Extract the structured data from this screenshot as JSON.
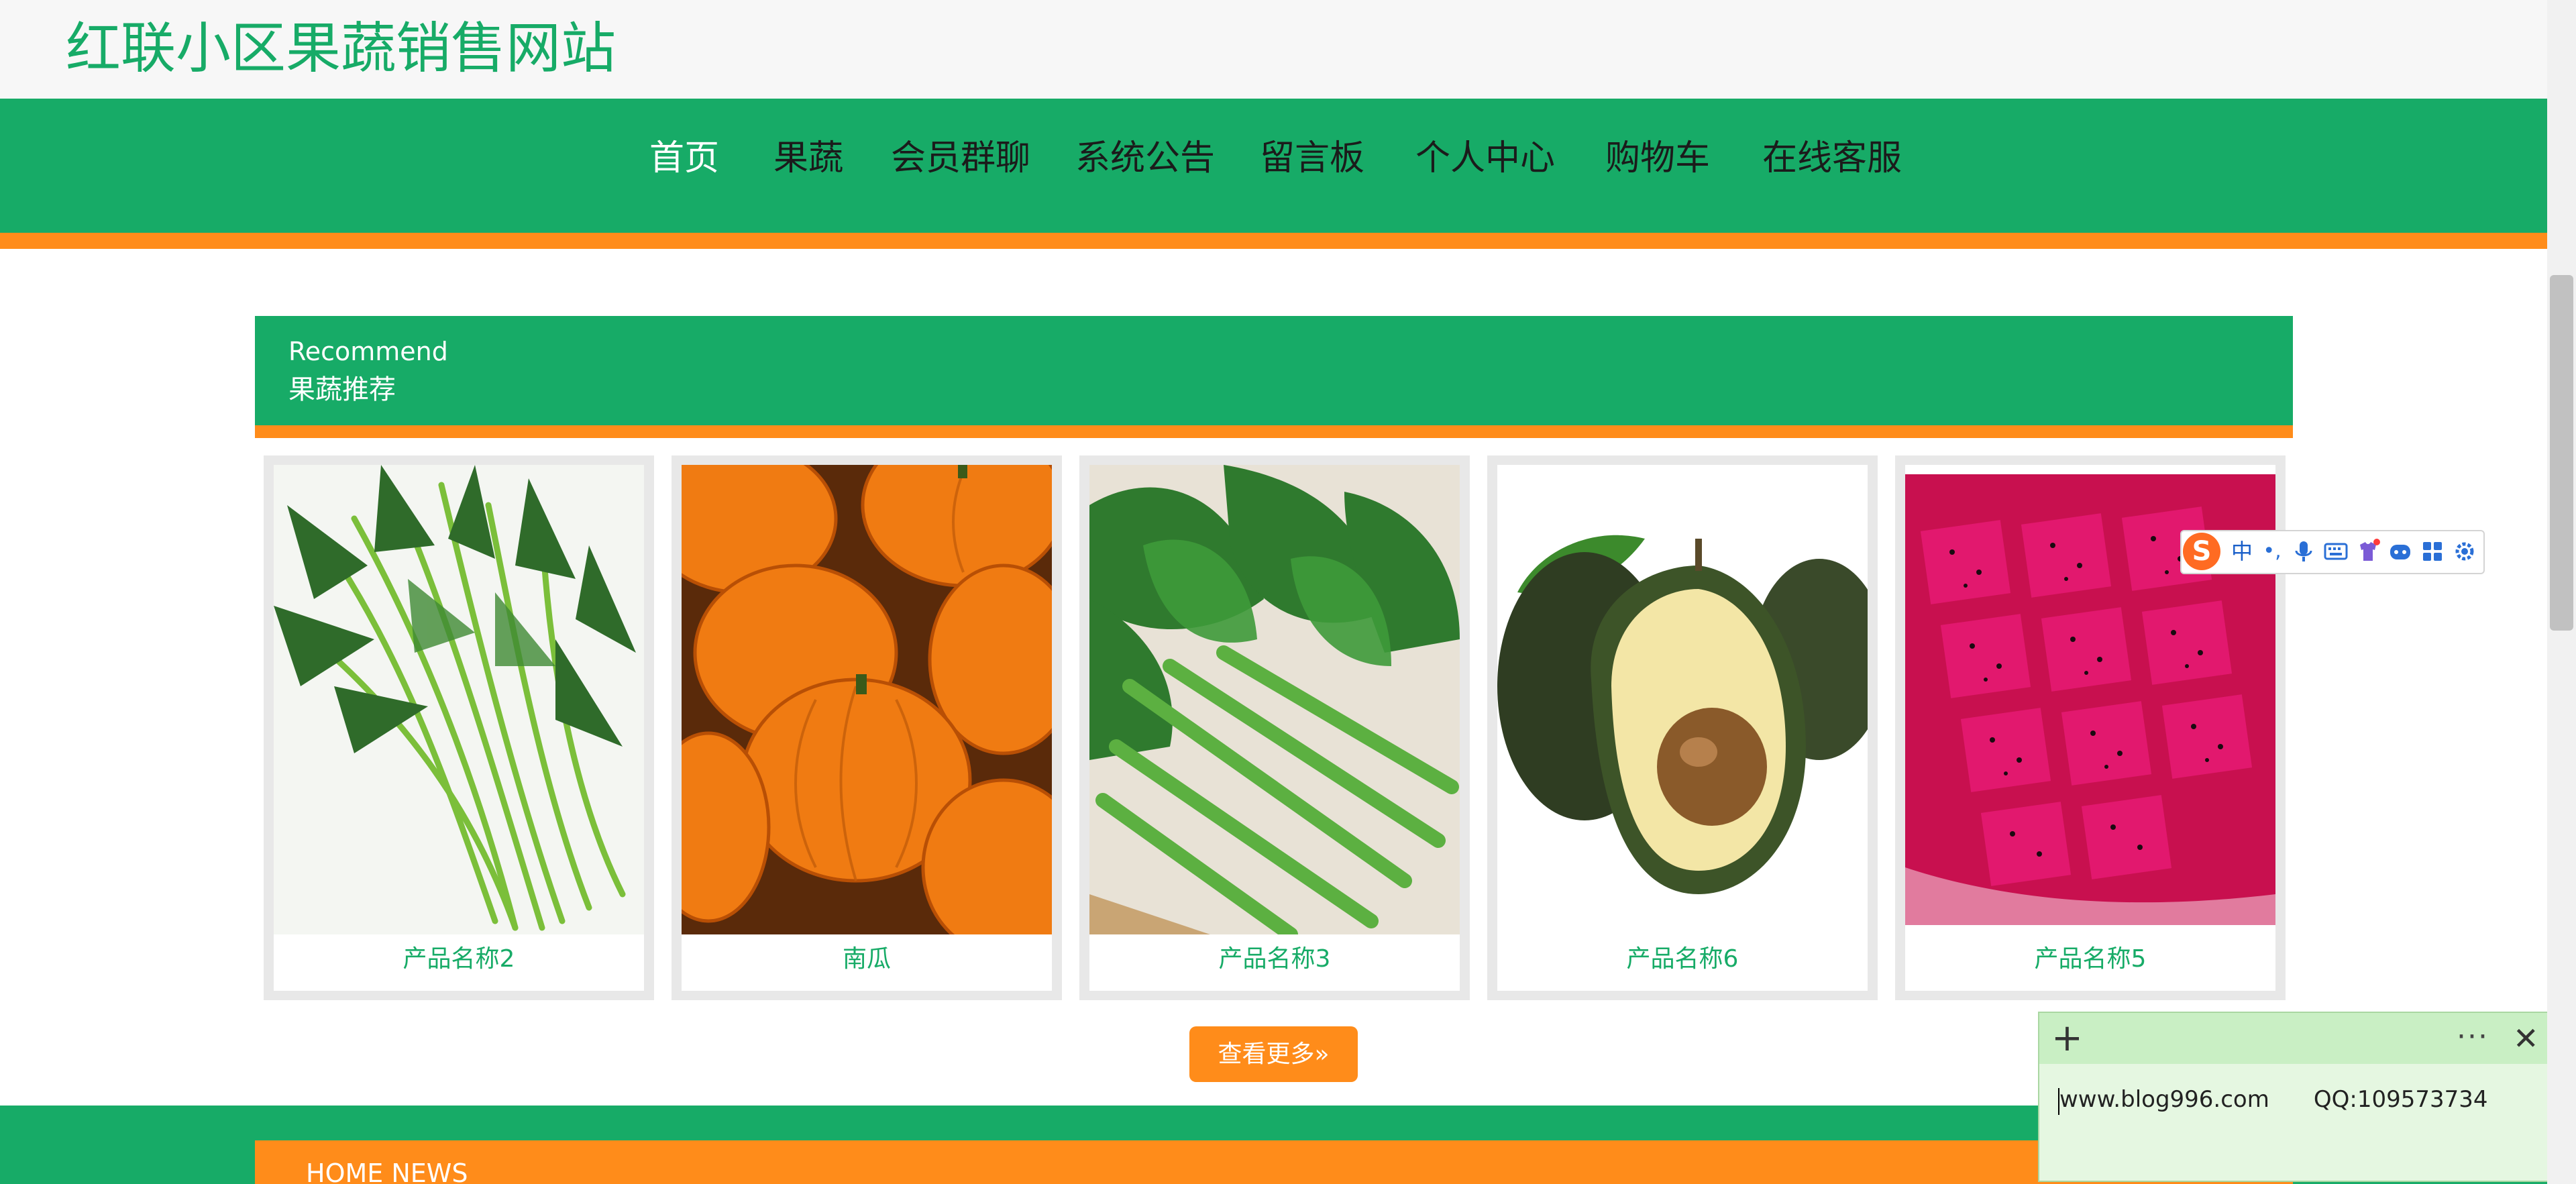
{
  "header": {
    "site_title": "红联小区果蔬销售网站"
  },
  "nav": {
    "items": [
      {
        "label": "首页",
        "active": true
      },
      {
        "label": "果蔬"
      },
      {
        "label": "会员群聊"
      },
      {
        "label": "系统公告"
      },
      {
        "label": "留言板"
      },
      {
        "label": "个人中心"
      },
      {
        "label": "购物车"
      },
      {
        "label": "在线客服"
      }
    ]
  },
  "recommend": {
    "title_en": "Recommend",
    "title_cn": "果蔬推荐",
    "products": [
      {
        "name": "产品名称2"
      },
      {
        "name": "南瓜"
      },
      {
        "name": "产品名称3"
      },
      {
        "name": "产品名称6"
      },
      {
        "name": "产品名称5"
      }
    ],
    "more_label": "查看更多»"
  },
  "news": {
    "title": "HOME NEWS"
  },
  "ime_toolbar": {
    "logo": "S",
    "mode": "中",
    "punct": "•,",
    "icons": [
      "microphone-icon",
      "keyboard-icon",
      "skin-icon",
      "emoji-icon",
      "toolbox-icon",
      "settings-icon"
    ]
  },
  "sticky_note": {
    "url": "www.blog996.com",
    "qq": "QQ:109573734",
    "plus": "+",
    "more": "···",
    "close": "✕"
  },
  "colors": {
    "brand_green": "#17ab67",
    "accent_orange": "#ff8c1a",
    "note_bg": "#e5f7e1"
  }
}
